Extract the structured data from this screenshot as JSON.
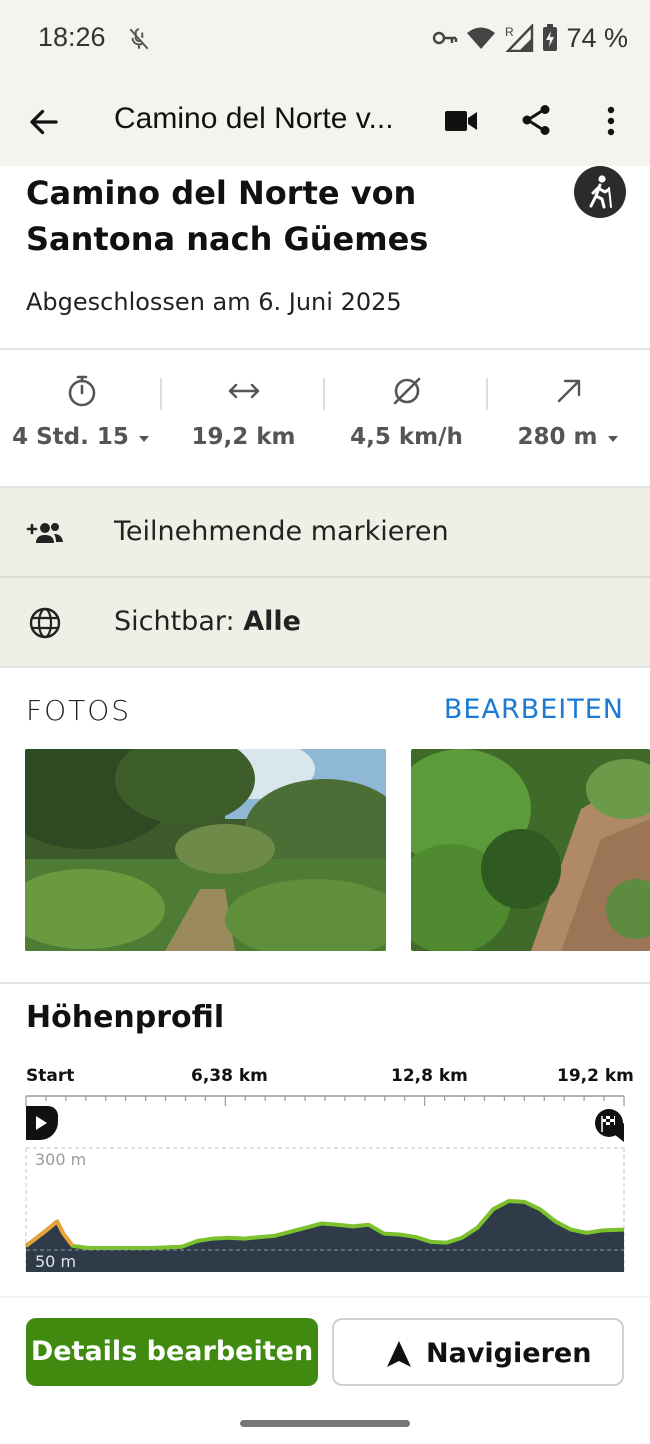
{
  "status": {
    "time": "18:26",
    "battery": "74 %",
    "network_roaming": "R"
  },
  "appbar": {
    "title": "Camino del Norte v..."
  },
  "tour": {
    "title": "Camino del Norte von Santona nach Güemes",
    "completed": "Abgeschlossen am 6. Juni 2025"
  },
  "stats": [
    {
      "icon": "stopwatch-icon",
      "value": "4 Std. 15"
    },
    {
      "icon": "distance-icon",
      "value": "19,2 km"
    },
    {
      "icon": "average-speed-icon",
      "value": "4,5 km/h"
    },
    {
      "icon": "ascent-icon",
      "value": "280 m"
    }
  ],
  "rows": {
    "participants": "Teilnehmende markieren",
    "visibility_label": "Sichtbar:",
    "visibility_value": "Alle"
  },
  "photos": {
    "heading": "FOTOS",
    "edit": "BEARBEITEN"
  },
  "elevation": {
    "heading": "Höhenprofil",
    "km_labels": [
      "Start",
      "6,38 km",
      "12,8 km",
      "19,2 km"
    ],
    "y_top": "300 m",
    "y_bottom": "50 m",
    "profile_km": [
      0,
      0.6,
      1.0,
      1.2,
      1.5,
      2.0,
      2.5,
      3.0,
      4.0,
      5.0,
      5.5,
      6.0,
      6.5,
      7.0,
      8.0,
      9.0,
      9.5,
      10.0,
      10.5,
      11.0,
      11.5,
      12.0,
      12.5,
      13.0,
      13.5,
      14.0,
      14.5,
      15.0,
      15.5,
      16.0,
      16.5,
      17.0,
      17.5,
      18.0,
      18.5,
      19.2
    ],
    "profile_m": [
      60,
      95,
      120,
      90,
      60,
      55,
      55,
      55,
      55,
      58,
      72,
      78,
      80,
      78,
      85,
      105,
      115,
      112,
      108,
      112,
      90,
      88,
      82,
      70,
      68,
      80,
      105,
      150,
      170,
      168,
      150,
      120,
      100,
      92,
      98,
      100
    ],
    "colors": {
      "fill": "#2f3b48",
      "line": "#7ac12d",
      "steep": "#e8a23a"
    }
  },
  "buttons": {
    "details": "Details bearbeiten",
    "navigate": "Navigieren"
  },
  "colors": {
    "accent_green": "#3f8a0f",
    "link_blue": "#1a7ad6",
    "header_bg": "#f4f3ee",
    "row_bg": "#f0efe6"
  }
}
